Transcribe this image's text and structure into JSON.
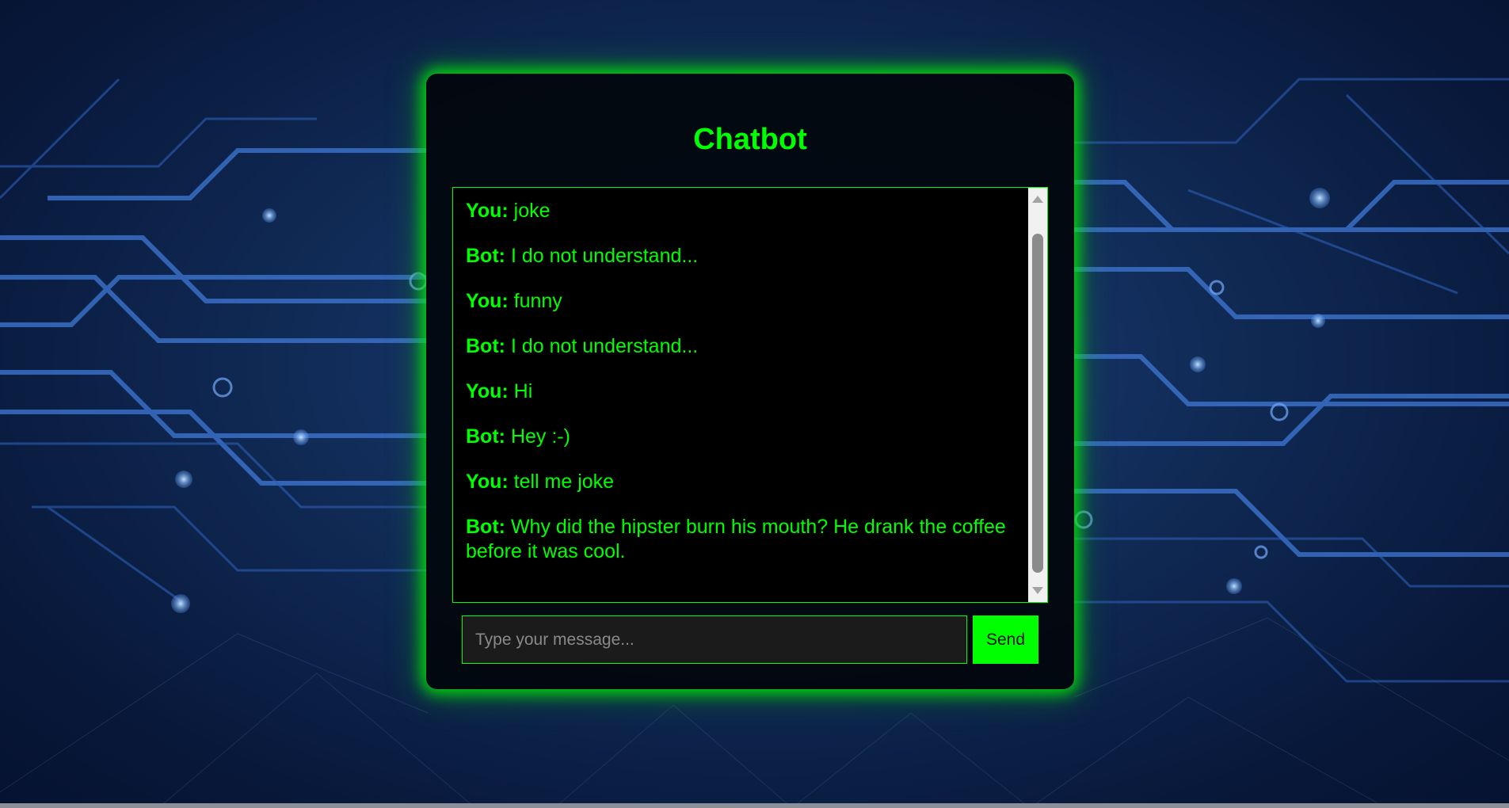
{
  "app": {
    "title": "Chatbot"
  },
  "conversation": {
    "messages": [
      {
        "sender": "You:",
        "text": "joke"
      },
      {
        "sender": "Bot:",
        "text": "I do not understand..."
      },
      {
        "sender": "You:",
        "text": "funny"
      },
      {
        "sender": "Bot:",
        "text": "I do not understand..."
      },
      {
        "sender": "You:",
        "text": "Hi"
      },
      {
        "sender": "Bot:",
        "text": "Hey :-)"
      },
      {
        "sender": "You:",
        "text": "tell me joke"
      },
      {
        "sender": "Bot:",
        "text": "Why did the hipster burn his mouth? He drank the coffee before it was cool."
      }
    ]
  },
  "composer": {
    "placeholder": "Type your message...",
    "value": "",
    "send_label": "Send"
  },
  "colors": {
    "accent": "#00ff00",
    "panel_background": "#000000",
    "page_background": "#102a55"
  }
}
